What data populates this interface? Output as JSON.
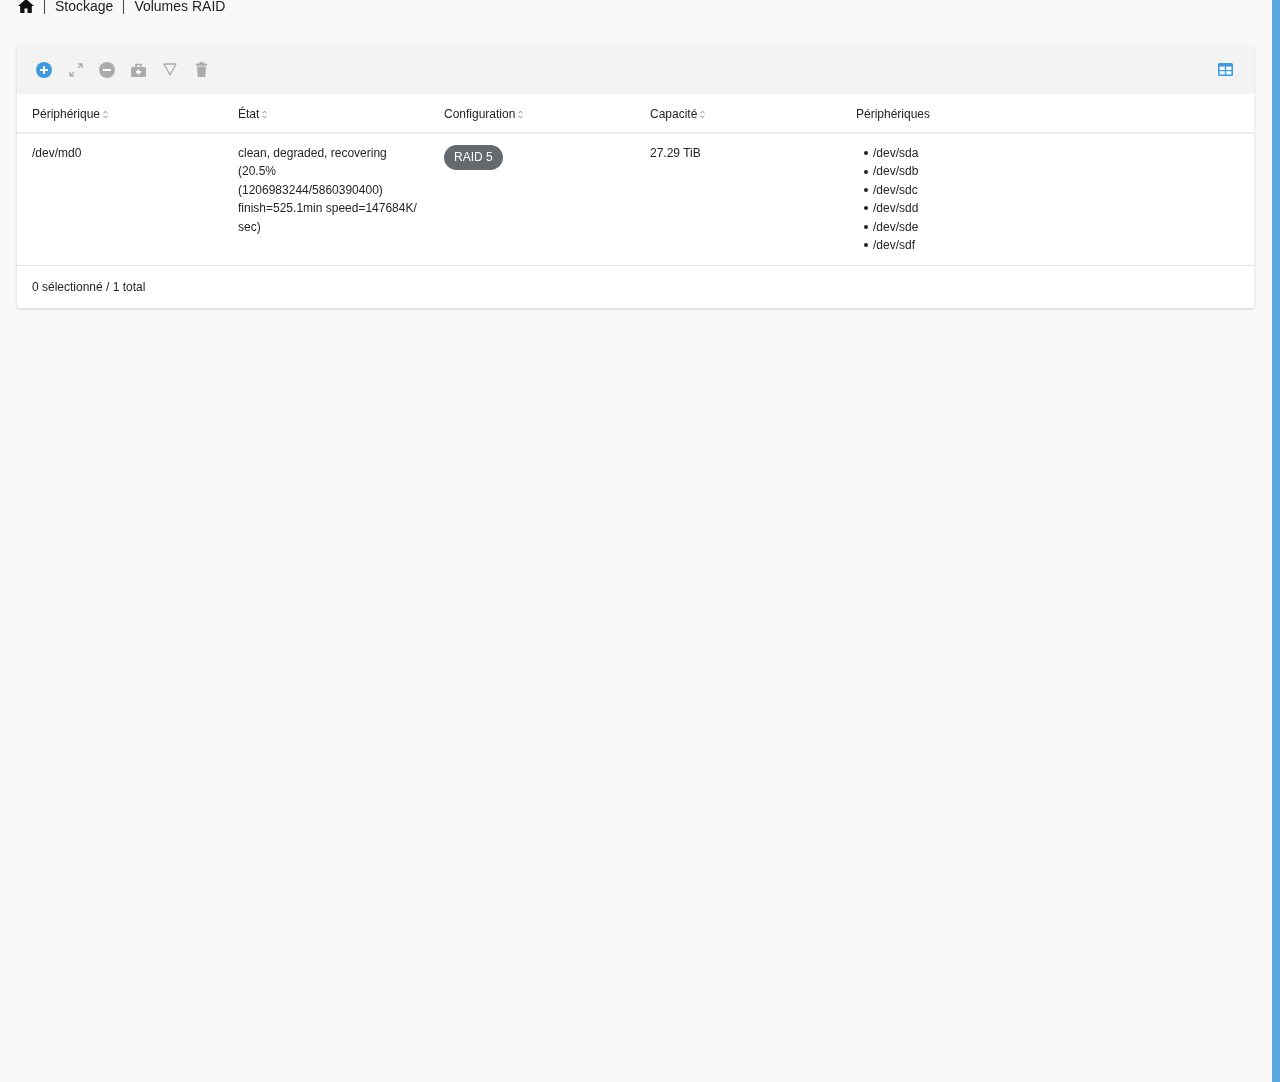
{
  "breadcrumb": {
    "items": [
      "Stockage",
      "Volumes RAID"
    ]
  },
  "toolbar": {
    "buttons": [
      {
        "kind": "add",
        "disabled": false
      },
      {
        "kind": "expand",
        "disabled": true
      },
      {
        "kind": "remove",
        "disabled": true
      },
      {
        "kind": "recover",
        "disabled": true
      },
      {
        "kind": "filter",
        "disabled": true
      },
      {
        "kind": "delete",
        "disabled": true
      }
    ],
    "view_toggle": {
      "kind": "columns",
      "disabled": false
    }
  },
  "table": {
    "columns": [
      {
        "label": "Périphérique",
        "sortable": true
      },
      {
        "label": "État",
        "sortable": true
      },
      {
        "label": "Configuration",
        "sortable": true
      },
      {
        "label": "Capacité",
        "sortable": true
      },
      {
        "label": "Périphériques",
        "sortable": false
      }
    ],
    "rows": [
      {
        "device": "/dev/md0",
        "state": "clean, degraded, recovering (20.5% (1206983244/5860390400) finish=525.1min speed=147684K/sec)",
        "configuration": "RAID 5",
        "capacity": "27.29 TiB",
        "members": [
          "/dev/sda",
          "/dev/sdb",
          "/dev/sdc",
          "/dev/sdd",
          "/dev/sde",
          "/dev/sdf"
        ],
        "selected": false
      }
    ]
  },
  "footer": {
    "summary": "0 sélectionné / 1 total"
  }
}
